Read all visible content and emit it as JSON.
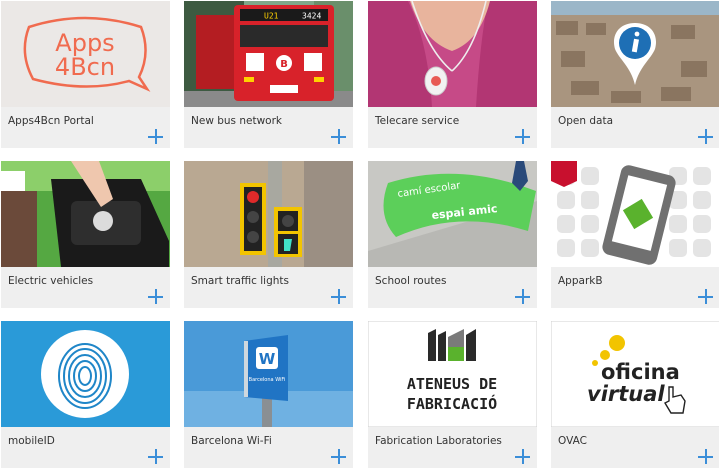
{
  "tiles": [
    {
      "label": "Apps4Bcn Portal",
      "icon": "apps4bcn-logo"
    },
    {
      "label": "New bus network",
      "icon": "bus-photo",
      "bus_display": "U21",
      "bus_number": "3424"
    },
    {
      "label": "Telecare service",
      "icon": "telecare-pendant-photo"
    },
    {
      "label": "Open data",
      "icon": "info-pin-icon"
    },
    {
      "label": "Electric vehicles",
      "icon": "ev-charging-photo"
    },
    {
      "label": "Smart traffic lights",
      "icon": "traffic-light-photo"
    },
    {
      "label": "School routes",
      "icon": "school-route-photo",
      "road_text_1": "camí escolar",
      "road_text_2": "espai amic"
    },
    {
      "label": "ApparkB",
      "icon": "phone-parking-icon"
    },
    {
      "label": "mobileID",
      "icon": "fingerprint-icon"
    },
    {
      "label": "Barcelona Wi-Fi",
      "icon": "wifi-sign-photo",
      "sign_text": "Barcelona WiFi"
    },
    {
      "label": "Fabrication Laboratories",
      "icon": "ateneus-logo",
      "logo_line1": "ATENEUS DE",
      "logo_line2": "FABRICACIÓ"
    },
    {
      "label": "OVAC",
      "icon": "oficina-virtual-logo",
      "logo_line1": "oficina",
      "logo_line2": "virtual"
    }
  ],
  "logo_text": {
    "apps4bcn_line1": "Apps",
    "apps4bcn_line2": "4Bcn"
  },
  "colors": {
    "accent": "#3b8ed8",
    "card_bg": "#efefef",
    "bus_red": "#d8222a",
    "traffic_yellow": "#f2c400",
    "school_green": "#5ccf5a",
    "brand_red": "#c8102e"
  }
}
